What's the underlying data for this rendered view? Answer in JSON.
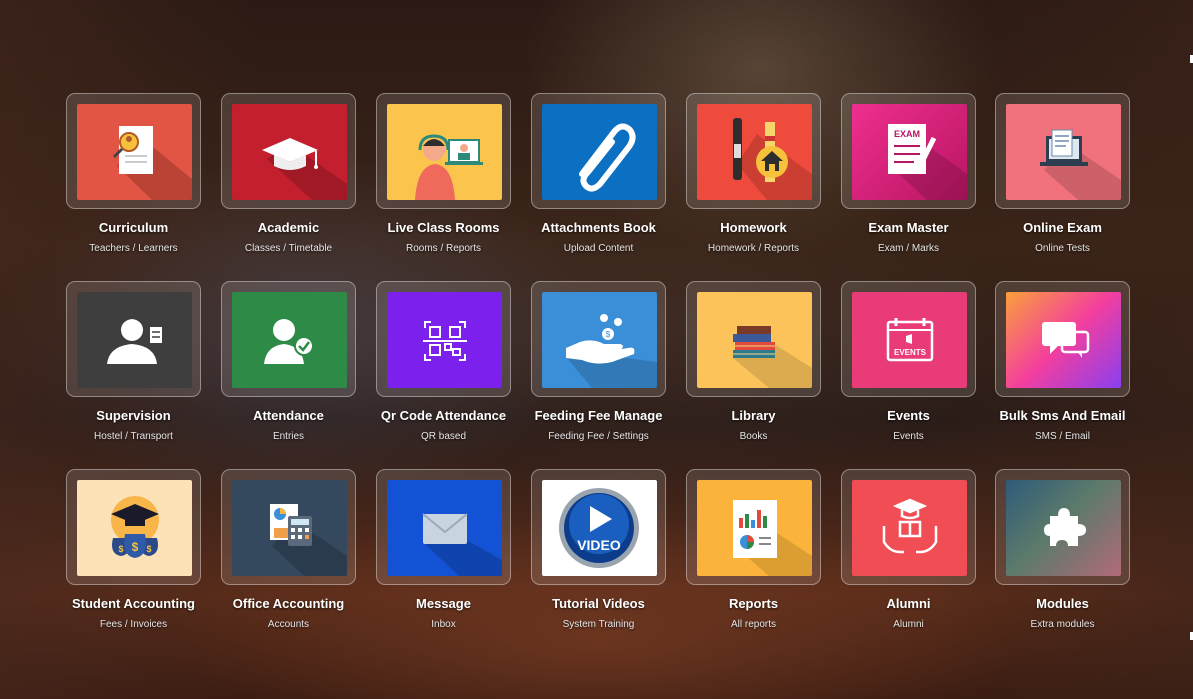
{
  "modules": [
    {
      "title": "Curriculum",
      "subtitle": "Teachers / Learners",
      "icon": "curriculum-icon",
      "color": "#e25443"
    },
    {
      "title": "Academic",
      "subtitle": "Classes / Timetable",
      "icon": "graduation-cap-icon",
      "color": "#c41f2e"
    },
    {
      "title": "Live Class Rooms",
      "subtitle": "Rooms / Reports",
      "icon": "live-class-icon",
      "color": "#fbc54d"
    },
    {
      "title": "Attachments Book",
      "subtitle": "Upload Content",
      "icon": "paperclip-icon",
      "color": "#0b6fc2"
    },
    {
      "title": "Homework",
      "subtitle": "Homework / Reports",
      "icon": "homework-icon",
      "color": "#ef4b3d"
    },
    {
      "title": "Exam Master",
      "subtitle": "Exam / Marks",
      "icon": "exam-icon",
      "color": "#e5267f"
    },
    {
      "title": "Online Exam",
      "subtitle": "Online Tests",
      "icon": "online-exam-icon",
      "color": "#f1727c"
    },
    {
      "title": "Supervision",
      "subtitle": "Hostel / Transport",
      "icon": "supervisor-icon",
      "color": "#3e3e3e"
    },
    {
      "title": "Attendance",
      "subtitle": "Entries",
      "icon": "attendance-icon",
      "color": "#2e8b47"
    },
    {
      "title": "Qr Code Attendance",
      "subtitle": "QR based",
      "icon": "qr-code-icon",
      "color": "#7c20ee"
    },
    {
      "title": "Feeding Fee Manage",
      "subtitle": "Feeding Fee / Settings",
      "icon": "fee-hand-icon",
      "color": "#3a8fd8"
    },
    {
      "title": "Library",
      "subtitle": "Books",
      "icon": "books-icon",
      "color": "#fbc35a"
    },
    {
      "title": "Events",
      "subtitle": "Events",
      "icon": "events-calendar-icon",
      "color": "#e83b78"
    },
    {
      "title": "Bulk Sms And Email",
      "subtitle": "SMS / Email",
      "icon": "chat-bubbles-icon",
      "color": "#f43f9d"
    },
    {
      "title": "Student Accounting",
      "subtitle": "Fees / Invoices",
      "icon": "money-bags-icon",
      "color": "#fce2b6"
    },
    {
      "title": "Office Accounting",
      "subtitle": "Accounts",
      "icon": "calculator-icon",
      "color": "#34495e"
    },
    {
      "title": "Message",
      "subtitle": "Inbox",
      "icon": "envelope-icon",
      "color": "#1352d4"
    },
    {
      "title": "Tutorial Videos",
      "subtitle": "System Training",
      "icon": "video-play-icon",
      "color": "#ffffff"
    },
    {
      "title": "Reports",
      "subtitle": "All reports",
      "icon": "report-chart-icon",
      "color": "#fbb33b"
    },
    {
      "title": "Alumni",
      "subtitle": "Alumni",
      "icon": "alumni-hands-icon",
      "color": "#f04d55"
    },
    {
      "title": "Modules",
      "subtitle": "Extra modules",
      "icon": "puzzle-piece-icon",
      "color": "#3f6a7a"
    }
  ],
  "labels": {
    "exam_badge": "EXAM",
    "events_badge": "EVENTS",
    "video_badge": "VIDEO"
  }
}
